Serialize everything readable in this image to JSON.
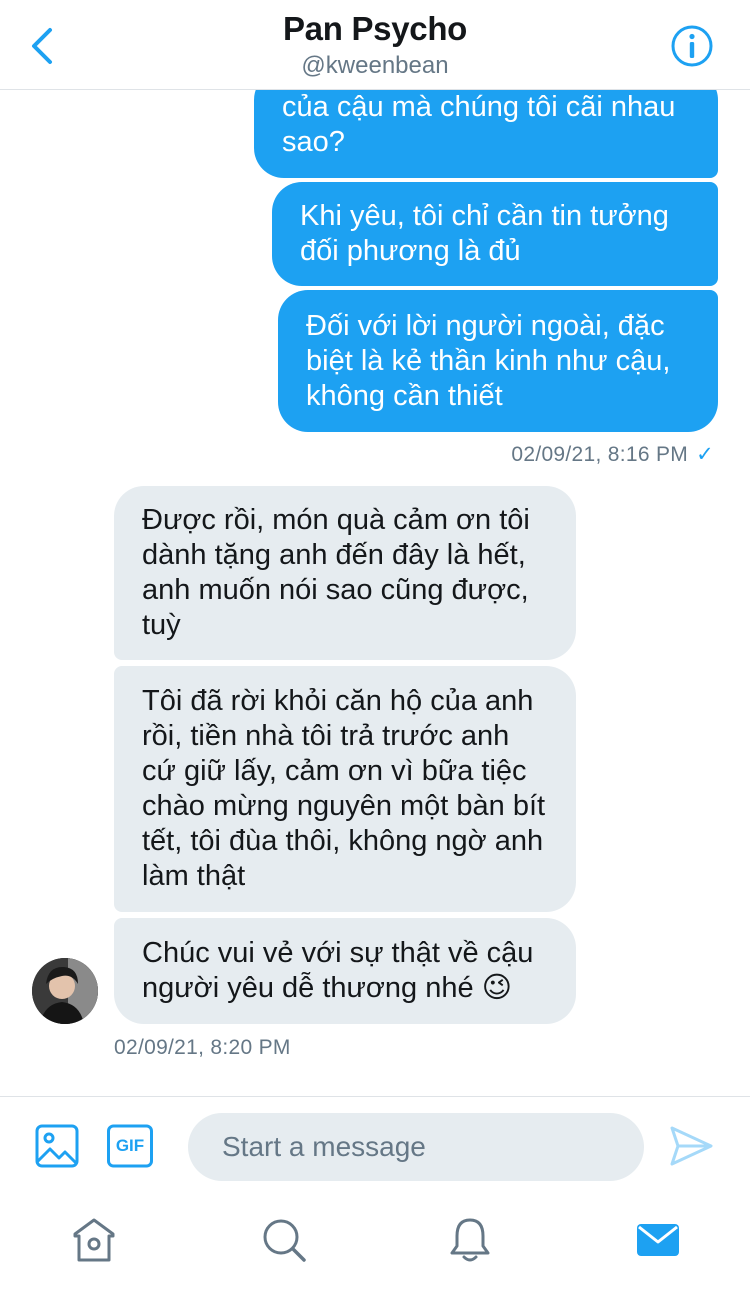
{
  "header": {
    "title": "Pan Psycho",
    "handle": "@kweenbean"
  },
  "messages": [
    {
      "direction": "outgoing",
      "text": "của cậu mà chúng tôi cãi nhau sao?"
    },
    {
      "direction": "outgoing",
      "text": "Khi yêu, tôi chỉ cần tin tưởng đối phương là đủ"
    },
    {
      "direction": "outgoing",
      "text": "Đối với lời người ngoài, đặc biệt là kẻ thần kinh như cậu, không cần thiết"
    },
    {
      "direction": "incoming",
      "text": "Được rồi, món quà cảm ơn tôi dành tặng anh đến đây là hết, anh muốn nói sao cũng được, tuỳ"
    },
    {
      "direction": "incoming",
      "text": "Tôi đã rời khỏi căn hộ của anh rồi, tiền nhà tôi trả trước anh cứ giữ lấy, cảm ơn vì bữa tiệc chào mừng nguyên một bàn bít tết, tôi đùa thôi, không ngờ anh làm thật"
    },
    {
      "direction": "incoming",
      "text": "Chúc vui vẻ với sự thật về cậu người yêu dễ thương nhé 😉"
    }
  ],
  "timestamps": {
    "outgoing": "02/09/21, 8:16 PM",
    "outgoing_status": "✓",
    "incoming": "02/09/21, 8:20 PM"
  },
  "composer": {
    "placeholder": "Start a message",
    "gif_label": "GIF"
  },
  "icons": [
    "back-icon",
    "info-icon",
    "image-icon",
    "gif-icon",
    "send-icon",
    "home-icon",
    "search-icon",
    "bell-icon",
    "mail-icon"
  ],
  "colors": {
    "accent": "#1da1f2",
    "incoming_bubble": "#e6ecf0",
    "muted": "#657786"
  }
}
